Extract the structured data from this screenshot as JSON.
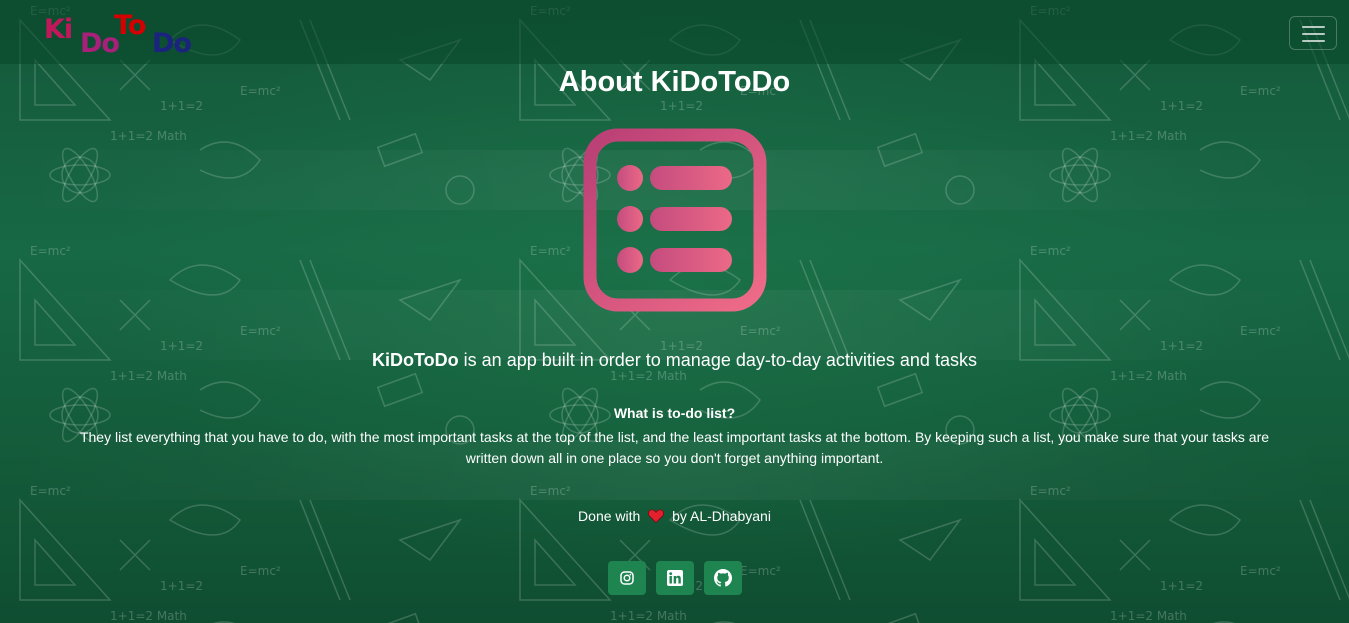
{
  "navbar": {
    "brand": {
      "parts": [
        {
          "text": "Ki",
          "color": "#c2185b"
        },
        {
          "text": "Do",
          "color": "#b71c8f"
        },
        {
          "text": "To",
          "color": "#d50000"
        },
        {
          "text": "Do",
          "color": "#1a237e"
        }
      ]
    },
    "toggler_icon": "hamburger-icon"
  },
  "main": {
    "title": "About KiDoToDo",
    "logo_icon": "list-icon",
    "tagline": {
      "brand": "KiDoToDo",
      "text": " is an app built in order to manage day-to-day activities and tasks"
    },
    "faq": {
      "question": "What is to-do list?",
      "answer": "They list everything that you have to do, with the most important tasks at the top of the list, and the least important tasks at the bottom. By keeping such a list, you make sure that your tasks are written down all in one place so you don't forget anything important."
    },
    "credit": {
      "prefix": "Done with",
      "icon": "heart-icon",
      "suffix": "by AL-Dhabyani"
    },
    "socials": [
      {
        "icon": "instagram-icon"
      },
      {
        "icon": "linkedin-icon"
      },
      {
        "icon": "github-icon"
      }
    ]
  },
  "colors": {
    "background": "#145e3a",
    "button": "#1e8450",
    "logo_gradient_start": "#c2477a",
    "logo_gradient_end": "#ee6a86",
    "heart": "#e3202d"
  }
}
